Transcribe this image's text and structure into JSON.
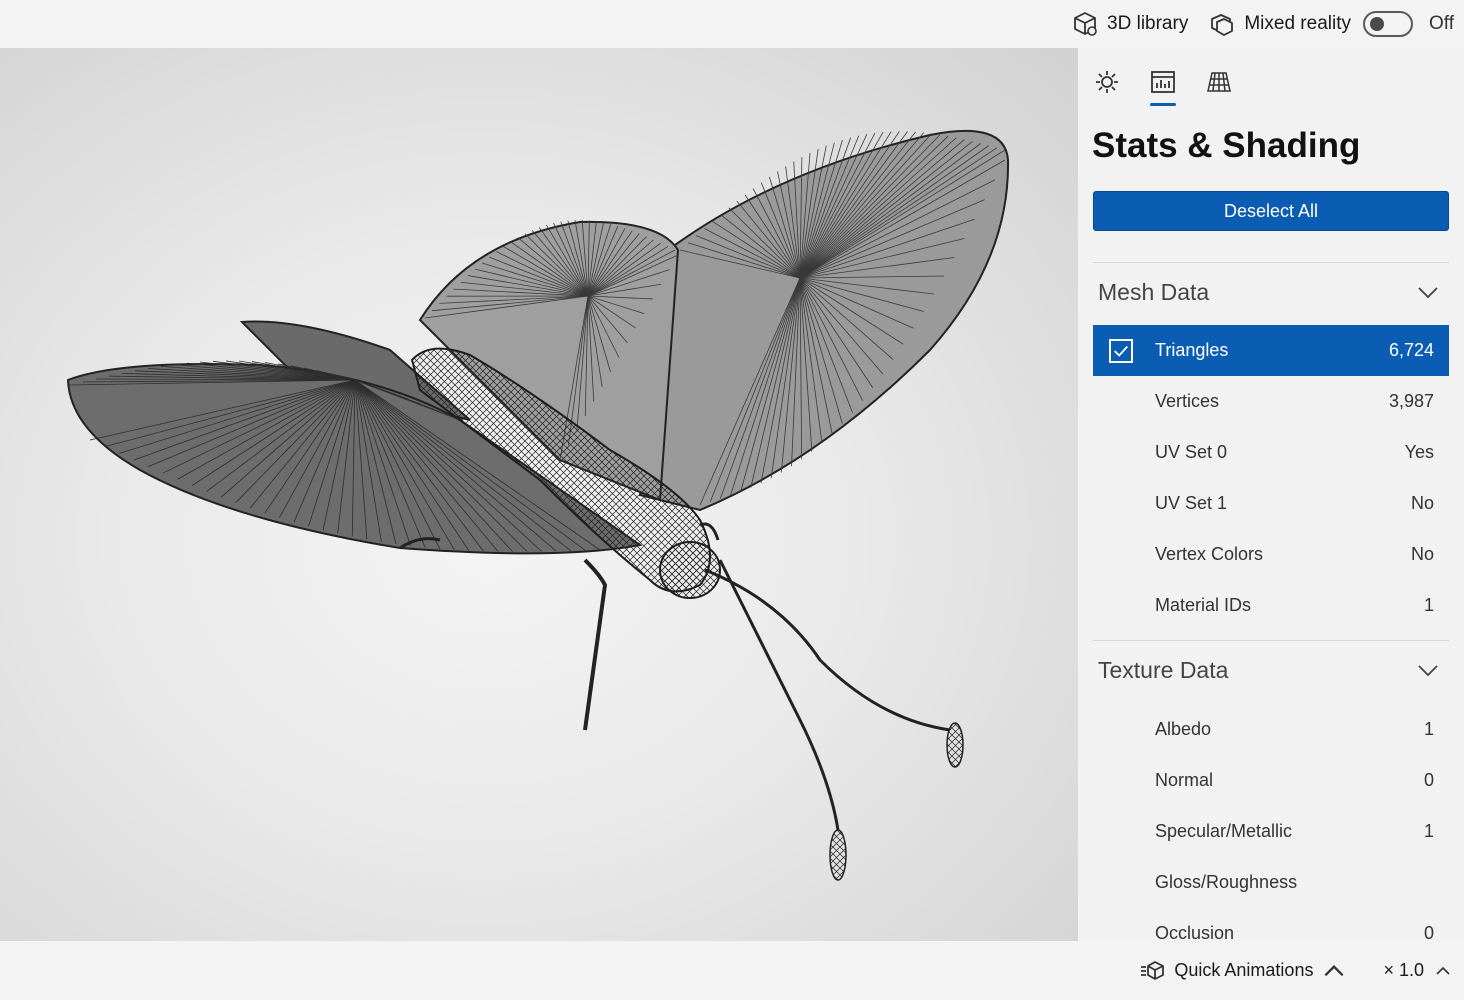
{
  "topbar": {
    "library_label": "3D library",
    "mixed_reality_label": "Mixed reality",
    "mixed_reality_state": "Off"
  },
  "panel": {
    "tabs": [
      {
        "icon": "lighting-icon",
        "active": false
      },
      {
        "icon": "stats-icon",
        "active": true
      },
      {
        "icon": "grid-icon",
        "active": false
      }
    ],
    "title": "Stats & Shading",
    "deselect_label": "Deselect All",
    "mesh": {
      "heading": "Mesh Data",
      "rows": [
        {
          "label": "Triangles",
          "value": "6,724"
        },
        {
          "label": "Vertices",
          "value": "3,987"
        },
        {
          "label": "UV Set 0",
          "value": "Yes"
        },
        {
          "label": "UV Set 1",
          "value": "No"
        },
        {
          "label": "Vertex Colors",
          "value": "No"
        },
        {
          "label": "Material IDs",
          "value": "1"
        }
      ]
    },
    "texture": {
      "heading": "Texture Data",
      "rows": [
        {
          "label": "Albedo",
          "value": "1"
        },
        {
          "label": "Normal",
          "value": "0"
        },
        {
          "label": "Specular/Metallic",
          "value": "1"
        },
        {
          "label": "Gloss/Roughness",
          "value": ""
        },
        {
          "label": "Occlusion",
          "value": "0"
        }
      ]
    }
  },
  "bottombar": {
    "quick_animations_label": "Quick Animations",
    "speed_label": "× 1.0"
  },
  "colors": {
    "accent": "#0a5db2",
    "panel_bg": "#f2f2f2",
    "model_fill": "#8a8a8a",
    "model_stroke": "#2a2a2a"
  }
}
